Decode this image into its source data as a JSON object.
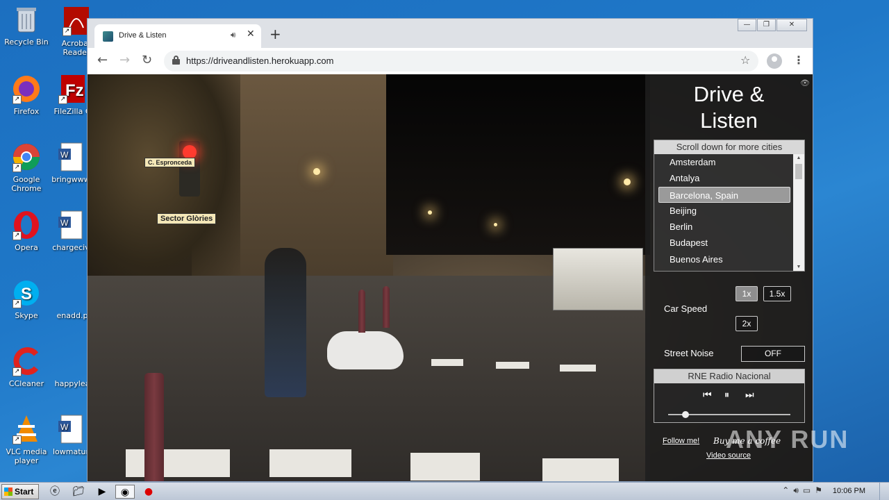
{
  "desktop": {
    "icons": [
      {
        "label": "Recycle Bin",
        "icon": "recycle-bin-icon"
      },
      {
        "label": "Acrobat Reader",
        "icon": "acrobat-icon"
      },
      {
        "label": "Firefox",
        "icon": "firefox-icon"
      },
      {
        "label": "FileZilla C",
        "icon": "filezilla-icon"
      },
      {
        "label": "Google Chrome",
        "icon": "chrome-icon"
      },
      {
        "label": "bringwww",
        "icon": "word-doc-icon"
      },
      {
        "label": "Opera",
        "icon": "opera-icon"
      },
      {
        "label": "chargeciv",
        "icon": "word-doc-icon"
      },
      {
        "label": "Skype",
        "icon": "skype-icon"
      },
      {
        "label": "enadd.p",
        "icon": "file-icon"
      },
      {
        "label": "CCleaner",
        "icon": "ccleaner-icon"
      },
      {
        "label": "happylea",
        "icon": "file-icon"
      },
      {
        "label": "VLC media player",
        "icon": "vlc-icon"
      },
      {
        "label": "lowmatur",
        "icon": "word-doc-icon"
      }
    ]
  },
  "browser": {
    "tab_title": "Drive & Listen",
    "url": "https://driveandlisten.herokuapp.com",
    "window_buttons": [
      "—",
      "❐",
      "✕"
    ]
  },
  "app": {
    "title_line1": "Drive &",
    "title_line2": "Listen",
    "city_header": "Scroll down for more cities",
    "cities": [
      "Amsterdam",
      "Antalya",
      "Barcelona, Spain",
      "Beijing",
      "Berlin",
      "Budapest",
      "Buenos Aires"
    ],
    "selected_city": "Barcelona, Spain",
    "car_speed_label": "Car Speed",
    "speed_options": [
      "1x",
      "1.5x",
      "2x"
    ],
    "selected_speed": "1x",
    "street_noise_label": "Street Noise",
    "street_noise_value": "OFF",
    "radio_station": "RNE Radio Nacional",
    "progress_fraction": 0.14,
    "follow_label": "Follow me!",
    "coffee_label": "Buy me a coffee",
    "video_source_label": "Video source"
  },
  "scene_signs": {
    "street_sign": "C. Espronceda",
    "direction_sign": "Sector Glòries"
  },
  "taskbar": {
    "start_label": "Start",
    "clock": "10:06 PM"
  },
  "watermark": "ANY RUN",
  "colors": {
    "panel_bg": "#1e1e1e",
    "selected_item": "#9a9a9a",
    "desktop_bg": "#1f78c8"
  }
}
